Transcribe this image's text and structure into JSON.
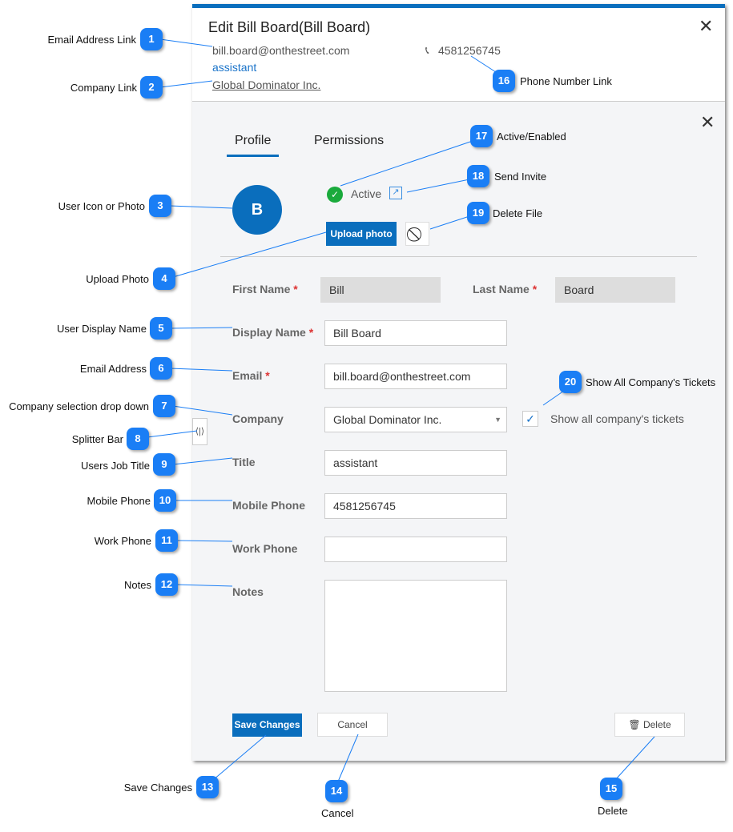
{
  "dialog": {
    "title": "Edit Bill Board(Bill Board)",
    "email_link": "bill.board@onthestreet.com",
    "job_title": "assistant",
    "company_link": "Global Dominator Inc.",
    "phone_link": "4581256745"
  },
  "tabs": [
    {
      "label": "Profile",
      "active": true
    },
    {
      "label": "Permissions",
      "active": false
    }
  ],
  "avatar": {
    "initial": "B"
  },
  "status": {
    "label": "Active",
    "enabled": true
  },
  "buttons": {
    "upload": "Upload photo",
    "save": "Save Changes",
    "cancel": "Cancel",
    "delete": "Delete"
  },
  "form": {
    "first_name": {
      "label": "First Name",
      "value": "Bill"
    },
    "last_name": {
      "label": "Last Name",
      "value": "Board"
    },
    "display_name": {
      "label": "Display Name",
      "value": "Bill Board"
    },
    "email": {
      "label": "Email",
      "value": "bill.board@onthestreet.com"
    },
    "company": {
      "label": "Company",
      "value": "Global Dominator Inc."
    },
    "title": {
      "label": "Title",
      "value": "assistant"
    },
    "mobile": {
      "label": "Mobile Phone",
      "value": "4581256745"
    },
    "work": {
      "label": "Work Phone",
      "value": ""
    },
    "notes": {
      "label": "Notes",
      "value": ""
    },
    "show_tickets": {
      "label": "Show all company's tickets",
      "checked": true
    },
    "required_mark": "*"
  },
  "colors": {
    "accent": "#0a6ebd",
    "badge": "#1a7ef5",
    "active": "#1aaa3c"
  },
  "callouts": [
    {
      "n": "1",
      "label": "Email Address Link"
    },
    {
      "n": "2",
      "label": "Company Link"
    },
    {
      "n": "3",
      "label": "User Icon or Photo"
    },
    {
      "n": "4",
      "label": "Upload Photo"
    },
    {
      "n": "5",
      "label": "User Display Name"
    },
    {
      "n": "6",
      "label": "Email Address"
    },
    {
      "n": "7",
      "label": "Company selection drop down"
    },
    {
      "n": "8",
      "label": "Splitter Bar"
    },
    {
      "n": "9",
      "label": "Users Job Title"
    },
    {
      "n": "10",
      "label": "Mobile Phone"
    },
    {
      "n": "11",
      "label": "Work Phone"
    },
    {
      "n": "12",
      "label": "Notes"
    },
    {
      "n": "13",
      "label": "Save Changes"
    },
    {
      "n": "14",
      "label": "Cancel"
    },
    {
      "n": "15",
      "label": "Delete"
    },
    {
      "n": "16",
      "label": "Phone Number Link"
    },
    {
      "n": "17",
      "label": "Active/Enabled"
    },
    {
      "n": "18",
      "label": "Send Invite"
    },
    {
      "n": "19",
      "label": "Delete File"
    },
    {
      "n": "20",
      "label": "Show All Company's Tickets"
    }
  ]
}
